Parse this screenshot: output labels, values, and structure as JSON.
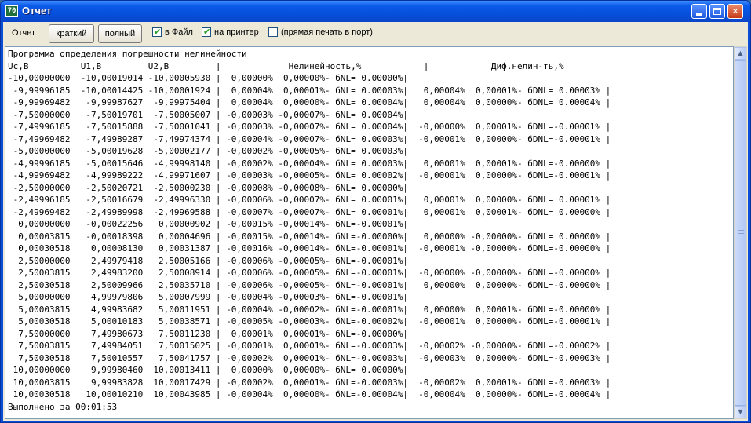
{
  "window": {
    "title": "Отчет",
    "app_icon_text": "70"
  },
  "toolbar": {
    "report_label": "Отчет",
    "short_label": "краткий",
    "full_label": "полный",
    "to_file_label": "в Файл",
    "to_file_checked": true,
    "to_printer_label": "на принтер",
    "to_printer_checked": true,
    "direct_print_label": "(прямая печать в порт)",
    "direct_print_checked": false
  },
  "report": {
    "text": "Программа определения погрешности нелинейности\nUc,B          U1,B         U2,B         |             Нелинейность,%            |            Диф.нелин-ть,%\n-10,00000000  -10,00019014 -10,00005930 |  0,00000%  0,00000%- бNL= 0.00000%|\n -9,99996185  -10,00014425 -10,00001924 |  0,00004%  0,00001%- бNL= 0.00003%|   0,00004%  0,00001%- бDNL= 0.00003% |\n -9,99969482   -9,99987627  -9,99975404 |  0,00004%  0,00000%- бNL= 0.00004%|   0,00004%  0,00000%- бDNL= 0.00004% |\n -7,50000000   -7,50019701  -7,50005007 | -0,00003% -0,00007%- бNL= 0.00004%|\n -7,49996185   -7,50015888  -7,50001041 | -0,00003% -0,00007%- бNL= 0.00004%|  -0,00000%  0,00001%- бDNL=-0.00001% |\n -7,49969482   -7,49989287  -7,49974374 | -0,00004% -0,00007%- бNL= 0.00003%|  -0,00001%  0,00000%- бDNL=-0.00001% |\n -5,00000000   -5,00019628  -5,00002177 | -0,00002% -0,00005%- бNL= 0.00003%|\n -4,99996185   -5,00015646  -4,99998140 | -0,00002% -0,00004%- бNL= 0.00003%|   0,00001%  0,00001%- бDNL=-0.00000% |\n -4,99969482   -4,99989222  -4,99971607 | -0,00003% -0,00005%- бNL= 0.00002%|  -0,00001%  0,00000%- бDNL=-0.00001% |\n -2,50000000   -2,50020721  -2,50000230 | -0,00008% -0,00008%- бNL= 0.00000%|\n -2,49996185   -2,50016679  -2,49996330 | -0,00006% -0,00007%- бNL= 0.00001%|   0,00001%  0,00000%- бDNL= 0.00001% |\n -2,49969482   -2,49989998  -2,49969588 | -0,00007% -0,00007%- бNL= 0.00001%|   0,00001%  0,00001%- бDNL= 0.00000% |\n  0,00000000   -0,00022256   0,00000902 | -0,00015% -0,00014%- бNL=-0.00001%|\n  0,00003815   -0,00018398   0,00004696 | -0,00015% -0,00014%- бNL=-0.00000%|   0,00000% -0,00000%- бDNL= 0.00000% |\n  0,00030518    0,00008130   0,00031387 | -0,00016% -0,00014%- бNL=-0.00001%|  -0,00001% -0,00000%- бDNL=-0.00000% |\n  2,50000000    2,49979418   2,50005166 | -0,00006% -0,00005%- бNL=-0.00001%|\n  2,50003815    2,49983200   2,50008914 | -0,00006% -0,00005%- бNL=-0.00001%|  -0,00000% -0,00000%- бDNL=-0.00000% |\n  2,50030518    2,50009966   2,50035710 | -0,00006% -0,00005%- бNL=-0.00001%|   0,00000%  0,00000%- бDNL=-0.00000% |\n  5,00000000    4,99979806   5,00007999 | -0,00004% -0,00003%- бNL=-0.00001%|\n  5,00003815    4,99983682   5,00011951 | -0,00004% -0,00002%- бNL=-0.00001%|   0,00000%  0,00001%- бDNL=-0.00000% |\n  5,00030518    5,00010183   5,00038571 | -0,00005% -0,00003%- бNL=-0.00002%|  -0,00001%  0,00000%- бDNL=-0.00001% |\n  7,50000000    7,49980673   7,50011230 |  0,00001%  0,00001%- бNL=-0.00000%|\n  7,50003815    7,49984051   7,50015025 | -0,00001%  0,00001%- бNL=-0.00003%|  -0,00002% -0,00000%- бDNL=-0.00002% |\n  7,50030518    7,50010557   7,50041757 | -0,00002%  0,00001%- бNL=-0.00003%|  -0,00003%  0,00000%- бDNL=-0.00003% |\n 10,00000000    9,99980460  10,00013411 |  0,00000%  0,00000%- бNL= 0.00000%|\n 10,00003815    9,99983828  10,00017429 | -0,00002%  0,00001%- бNL=-0.00003%|  -0,00002%  0,00001%- бDNL=-0.00003% |\n 10,00030518   10,00010210  10,00043985 | -0,00004%  0,00000%- бNL=-0.00004%|  -0,00004%  0,00000%- бDNL=-0.00004% |\nВыполнено за 00:01:53"
  },
  "icons": {
    "minimize": "minimize-icon",
    "maximize": "maximize-icon",
    "close": "close-icon",
    "close_glyph": "✕",
    "scroll_up_glyph": "▲",
    "scroll_down_glyph": "▼"
  }
}
